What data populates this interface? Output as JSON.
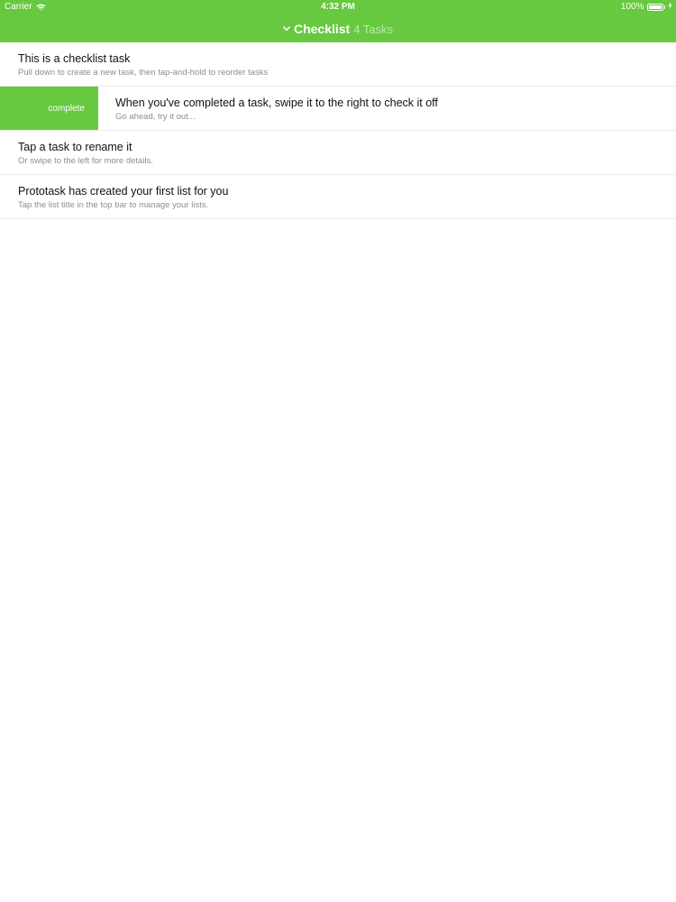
{
  "status_bar": {
    "carrier": "Carrier",
    "time": "4:32 PM",
    "battery_percent": "100%",
    "battery_level": 1.0,
    "icons": [
      "wifi-icon",
      "battery-icon",
      "charging-bolt-icon"
    ]
  },
  "header": {
    "title": "Checklist",
    "count_label": "4 Tasks",
    "chevron_icon": "chevron-down-icon",
    "color": "#67c940"
  },
  "tasks": [
    {
      "title": "This is a checklist task",
      "subtitle": "Pull down to create a new task, then tap-and-hold to reorder tasks"
    },
    {
      "title": "When you've completed a task, swipe it to the right to check it off",
      "subtitle": "Go ahead, try it out...",
      "swipe_label": "complete"
    },
    {
      "title": "Tap a task to rename it",
      "subtitle": "Or swipe to the left for more details."
    },
    {
      "title": "Prototask has created your first list for you",
      "subtitle": "Tap the list title in the top bar to manage your lists."
    }
  ]
}
